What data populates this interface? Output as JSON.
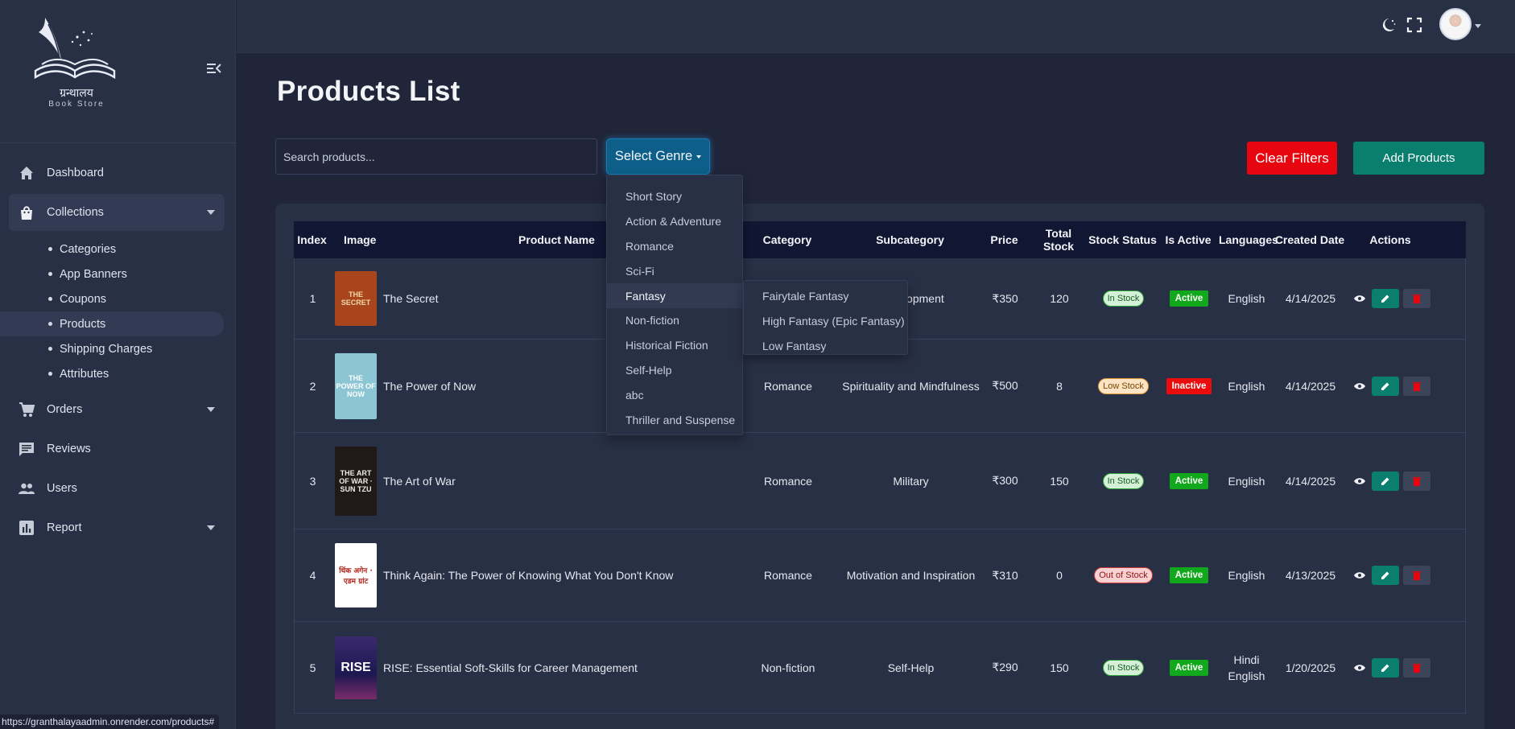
{
  "brand": {
    "logo_text": "ग्रन्थालय",
    "logo_sub": "Book Store"
  },
  "sidebar": {
    "items": [
      {
        "label": "Dashboard",
        "icon": "home-icon"
      },
      {
        "label": "Collections",
        "icon": "shopping-bag-icon",
        "expanded": true,
        "children": [
          "Categories",
          "App Banners",
          "Coupons",
          "Products",
          "Shipping Charges",
          "Attributes"
        ],
        "active_child": "Products"
      },
      {
        "label": "Orders",
        "icon": "cart-icon",
        "has_caret": true
      },
      {
        "label": "Reviews",
        "icon": "comment-icon"
      },
      {
        "label": "Users",
        "icon": "users-icon"
      },
      {
        "label": "Report",
        "icon": "chart-icon",
        "has_caret": true
      }
    ]
  },
  "status_url": "https://granthalayaadmin.onrender.com/products#",
  "header": {
    "icons": [
      "theme-toggle-icon",
      "fullscreen-icon",
      "avatar"
    ]
  },
  "page": {
    "title": "Products List",
    "search_placeholder": "Search products...",
    "genre_button": "Select Genre",
    "clear_button": "Clear Filters",
    "add_button": "Add Products"
  },
  "genre_dropdown": {
    "items": [
      "Short Story",
      "Action & Adventure",
      "Romance",
      "Sci-Fi",
      "Fantasy",
      "Non-fiction",
      "Historical Fiction",
      "Self-Help",
      "abc",
      "Thriller and Suspense"
    ],
    "active": "Fantasy",
    "submenu": [
      "Fairytale Fantasy",
      "High Fantasy (Epic Fantasy)",
      "Low Fantasy"
    ]
  },
  "table": {
    "headers": [
      "Index",
      "Image",
      "Product Name",
      "Category",
      "Subcategory",
      "Price",
      "Total Stock",
      "Stock Status",
      "Is Active",
      "Languages",
      "Created Date",
      "Actions"
    ],
    "rows": [
      {
        "index": "1",
        "name": "The Secret",
        "category": "",
        "subcategory": "Development",
        "price": "₹350",
        "stock": "120",
        "status": "In Stock",
        "active": "Active",
        "lang": "English",
        "date": "4/14/2025"
      },
      {
        "index": "2",
        "name": "The Power of Now",
        "category": "Romance",
        "subcategory": "Spirituality and Mindfulness",
        "price": "₹500",
        "stock": "8",
        "status": "Low Stock",
        "active": "Inactive",
        "lang": "English",
        "date": "4/14/2025"
      },
      {
        "index": "3",
        "name": "The Art of War",
        "category": "Romance",
        "subcategory": "Military",
        "price": "₹300",
        "stock": "150",
        "status": "In Stock",
        "active": "Active",
        "lang": "English",
        "date": "4/14/2025"
      },
      {
        "index": "4",
        "name": "Think Again: The Power of Knowing What You Don't Know",
        "category": "Romance",
        "subcategory": "Motivation and Inspiration",
        "price": "₹310",
        "stock": "0",
        "status": "Out of Stock",
        "active": "Active",
        "lang": "English",
        "date": "4/13/2025"
      },
      {
        "index": "5",
        "name": "RISE: Essential Soft-Skills for Career Management",
        "category": "Non-fiction",
        "subcategory": "Self-Help",
        "price": "₹290",
        "stock": "150",
        "status": "In Stock",
        "active": "Active",
        "lang": "Hindi English",
        "date": "1/20/2025"
      }
    ]
  },
  "covers": [
    {
      "text": "THE SECRET",
      "bg": "#a8451c",
      "fg": "#f4d9a8"
    },
    {
      "text": "THE POWER OF NOW",
      "bg": "#8cc5d3",
      "fg": "#ffffff"
    },
    {
      "text": "THE ART OF WAR · SUN TZU",
      "bg": "#1f1a17",
      "fg": "#f0ede6"
    },
    {
      "text": "थिंक अगेन · एडम ग्रांट",
      "bg": "#ffffff",
      "fg": "#b0271f"
    },
    {
      "text": "RISE",
      "bg": "#231e58",
      "fg": "#ffffff"
    }
  ],
  "colors": {
    "primary": "#0d5f8a",
    "success": "#0a7f6f",
    "danger": "#e70510",
    "sidebar": "#283046",
    "background": "#20253a"
  }
}
